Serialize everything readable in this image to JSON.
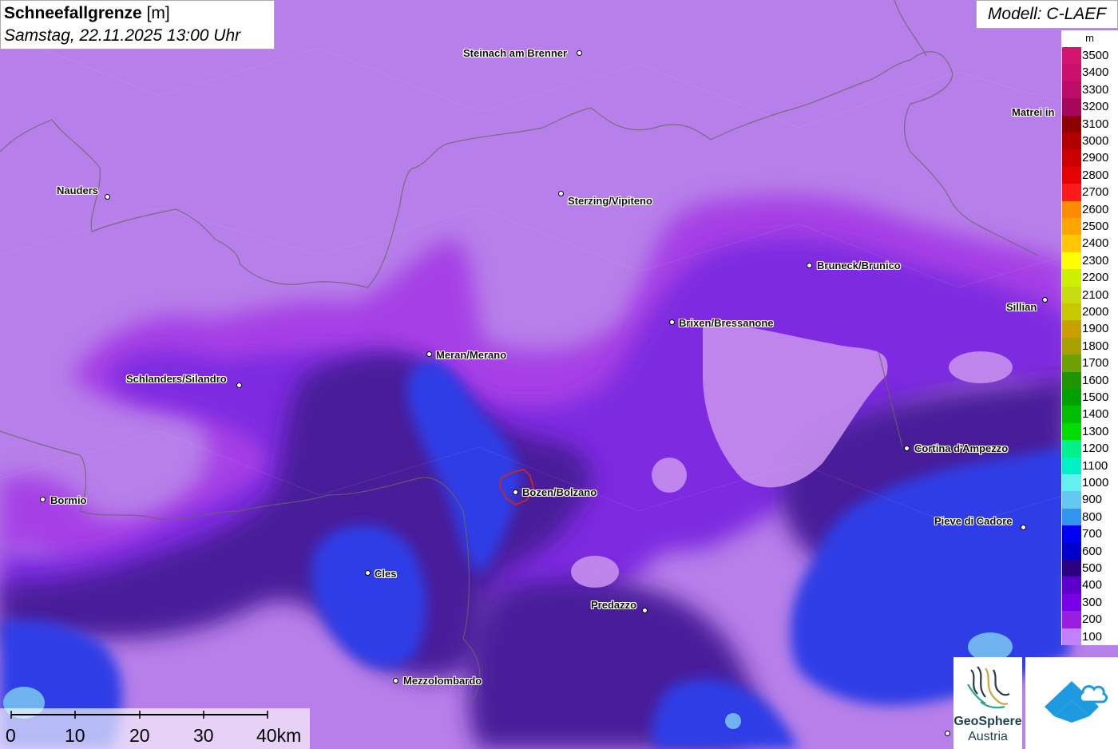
{
  "title": {
    "variable": "Schneefallgrenze",
    "unit": "[m]",
    "datetime": "Samstag, 22.11.2025 13:00 Uhr"
  },
  "model": "Modell: C-LAEF",
  "legend": {
    "unit": "m",
    "entries": [
      {
        "label": "3500",
        "color": "#d4146e"
      },
      {
        "label": "3400",
        "color": "#cc0f6a"
      },
      {
        "label": "3300",
        "color": "#bd0c68"
      },
      {
        "label": "3200",
        "color": "#a5075a"
      },
      {
        "label": "3100",
        "color": "#8c0000"
      },
      {
        "label": "3000",
        "color": "#b20000"
      },
      {
        "label": "2900",
        "color": "#cc0000"
      },
      {
        "label": "2800",
        "color": "#e60000"
      },
      {
        "label": "2700",
        "color": "#ff1a1a"
      },
      {
        "label": "2600",
        "color": "#ff8c00"
      },
      {
        "label": "2500",
        "color": "#ffa500"
      },
      {
        "label": "2400",
        "color": "#ffc800"
      },
      {
        "label": "2300",
        "color": "#ffff00"
      },
      {
        "label": "2200",
        "color": "#ccf000"
      },
      {
        "label": "2100",
        "color": "#c8dc10"
      },
      {
        "label": "2000",
        "color": "#c8c800"
      },
      {
        "label": "1900",
        "color": "#c8a000"
      },
      {
        "label": "1800",
        "color": "#a8a000"
      },
      {
        "label": "1700",
        "color": "#6ea000"
      },
      {
        "label": "1600",
        "color": "#1e9600"
      },
      {
        "label": "1500",
        "color": "#00a000"
      },
      {
        "label": "1400",
        "color": "#00be00"
      },
      {
        "label": "1300",
        "color": "#00dc00"
      },
      {
        "label": "1200",
        "color": "#00f08c"
      },
      {
        "label": "1100",
        "color": "#00f0c8"
      },
      {
        "label": "1000",
        "color": "#64f0f0"
      },
      {
        "label": "900",
        "color": "#64c8f0"
      },
      {
        "label": "800",
        "color": "#3296f0"
      },
      {
        "label": "700",
        "color": "#0000f0"
      },
      {
        "label": "600",
        "color": "#0000c8"
      },
      {
        "label": "500",
        "color": "#2a0080"
      },
      {
        "label": "400",
        "color": "#5a00c8"
      },
      {
        "label": "300",
        "color": "#7800e6"
      },
      {
        "label": "200",
        "color": "#9a1ee0"
      },
      {
        "label": "100",
        "color": "#c080ff"
      }
    ]
  },
  "cities": [
    {
      "name": "Steinach am Brenner"
    },
    {
      "name": "Matrei in"
    },
    {
      "name": "Nauders"
    },
    {
      "name": "Sterzing/Vipiteno"
    },
    {
      "name": "Bruneck/Brunico"
    },
    {
      "name": "Sillian"
    },
    {
      "name": "Brixen/Bressanone"
    },
    {
      "name": "Meran/Merano"
    },
    {
      "name": "Schlanders/Silandro"
    },
    {
      "name": "Cortina d'Ampezzo"
    },
    {
      "name": "Bormio"
    },
    {
      "name": "Bozen/Bolzano"
    },
    {
      "name": "Pieve di Cadore"
    },
    {
      "name": "Cles"
    },
    {
      "name": "Predazzo"
    },
    {
      "name": "Mezzolombardo"
    }
  ],
  "scale_bar": {
    "labels": [
      "0",
      "10",
      "20",
      "30",
      "40km"
    ]
  },
  "logos": {
    "geosphere_line1": "GeoSphere",
    "geosphere_line2": "Austria"
  }
}
